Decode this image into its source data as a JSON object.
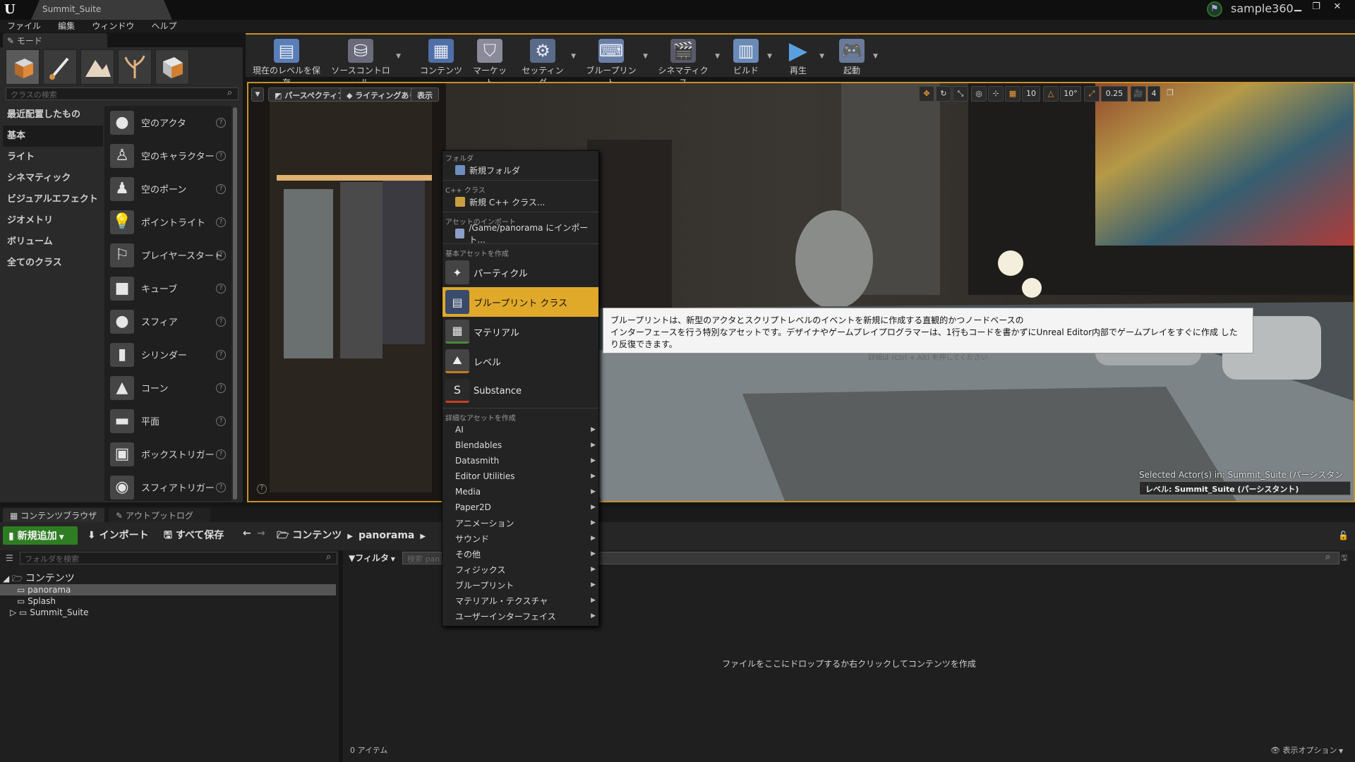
{
  "window": {
    "level_tab": "Summit_Suite",
    "project_name": "sample360"
  },
  "menubar": [
    "ファイル",
    "編集",
    "ウィンドウ",
    "ヘルプ"
  ],
  "modes": {
    "tab_label": "モード",
    "search_placeholder": "クラスの検索",
    "categories": [
      "最近配置したもの",
      "基本",
      "ライト",
      "シネマティック",
      "ビジュアルエフェクト",
      "ジオメトリ",
      "ボリューム",
      "全てのクラス"
    ],
    "active_category": "基本",
    "actors": [
      {
        "label": "空のアクタ",
        "icon": "sphere-icon"
      },
      {
        "label": "空のキャラクター",
        "icon": "character-icon"
      },
      {
        "label": "空のポーン",
        "icon": "pawn-icon"
      },
      {
        "label": "ポイントライト",
        "icon": "lightbulb-icon"
      },
      {
        "label": "プレイヤースタート",
        "icon": "player-start-icon"
      },
      {
        "label": "キューブ",
        "icon": "cube-icon"
      },
      {
        "label": "スフィア",
        "icon": "sphere-icon"
      },
      {
        "label": "シリンダー",
        "icon": "cylinder-icon"
      },
      {
        "label": "コーン",
        "icon": "cone-icon"
      },
      {
        "label": "平面",
        "icon": "plane-icon"
      },
      {
        "label": "ボックストリガー",
        "icon": "box-trigger-icon"
      },
      {
        "label": "スフィアトリガー",
        "icon": "sphere-trigger-icon"
      }
    ]
  },
  "toolbar": [
    {
      "label": "現在のレベルを保存",
      "icon": "save-icon"
    },
    {
      "label": "ソースコントロール",
      "icon": "source-control-icon"
    },
    {
      "label": "コンテンツ",
      "icon": "content-icon"
    },
    {
      "label": "マーケット",
      "icon": "marketplace-icon"
    },
    {
      "label": "セッティング",
      "icon": "settings-icon"
    },
    {
      "label": "ブループリント",
      "icon": "blueprint-icon"
    },
    {
      "label": "シネマティクス",
      "icon": "cinematics-icon"
    },
    {
      "label": "ビルド",
      "icon": "build-icon"
    },
    {
      "label": "再生",
      "icon": "play-icon"
    },
    {
      "label": "起動",
      "icon": "launch-icon"
    }
  ],
  "viewport": {
    "perspective": "パースペクティブ",
    "lighting": "ライティングあり",
    "show": "表示",
    "grid_snap": "10",
    "rot_snap": "10°",
    "scale_snap": "0.25",
    "cam_speed": "4",
    "selected_actors": "Selected Actor(s) in:  Summit_Suite (パーシスタント)",
    "level_label": "レベル:  Summit_Suite (パーシスタント)"
  },
  "context_menu": {
    "folder_head": "フォルダ",
    "new_folder": "新規フォルダ",
    "cpp_head": "C++ クラス",
    "new_cpp": "新規 C++ クラス...",
    "import_head": "アセットのインポート",
    "import_path": "/Game/panorama にインポート...",
    "basic_head": "基本アセットを作成",
    "basic": [
      {
        "label": "パーティクル",
        "icon": "particle-icon",
        "hl": false
      },
      {
        "label": "ブループリント クラス",
        "icon": "blueprint-class-icon",
        "hl": true
      },
      {
        "label": "マテリアル",
        "icon": "material-icon",
        "hl": false
      },
      {
        "label": "レベル",
        "icon": "level-icon",
        "hl": false
      },
      {
        "label": "Substance",
        "icon": "substance-icon",
        "hl": false
      }
    ],
    "advanced_head": "詳細なアセットを作成",
    "advanced": [
      "AI",
      "Blendables",
      "Datasmith",
      "Editor Utilities",
      "Media",
      "Paper2D",
      "アニメーション",
      "サウンド",
      "その他",
      "フィジックス",
      "ブループリント",
      "マテリアル・テクスチャ",
      "ユーザーインターフェイス"
    ]
  },
  "tooltip": {
    "line1": "ブループリントは、新型のアクタとスクリプトレベルのイベントを新規に作成する直観的かつノードベースの",
    "line2": "インターフェースを行う特別なアセットです。デザイナやゲームプレイプログラマーは、1行もコードを書かずにUnreal Editor内部でゲームプレイをすぐに作成 したり反復できます。",
    "hint": "詳細は (Ctrl + Alt) を押してください"
  },
  "bottom": {
    "tab_content": "コンテンツブラウザ",
    "tab_outliner": "アウトプットログ",
    "add_new": "新規追加",
    "import": "インポート",
    "save_all": "すべて保存",
    "crumb_root": "コンテンツ",
    "crumb_folder": "panorama",
    "folder_search": "フォルダを検索",
    "filter": "フィルタ",
    "asset_search": "検索 pan",
    "tree_root": "コンテンツ",
    "tree": [
      "panorama",
      "Splash",
      "Summit_Suite"
    ],
    "empty_message": "ファイルをここにドロップするか右クリックしてコンテンツを作成",
    "item_count": "0 アイテム",
    "view_options": "表示オプション"
  }
}
